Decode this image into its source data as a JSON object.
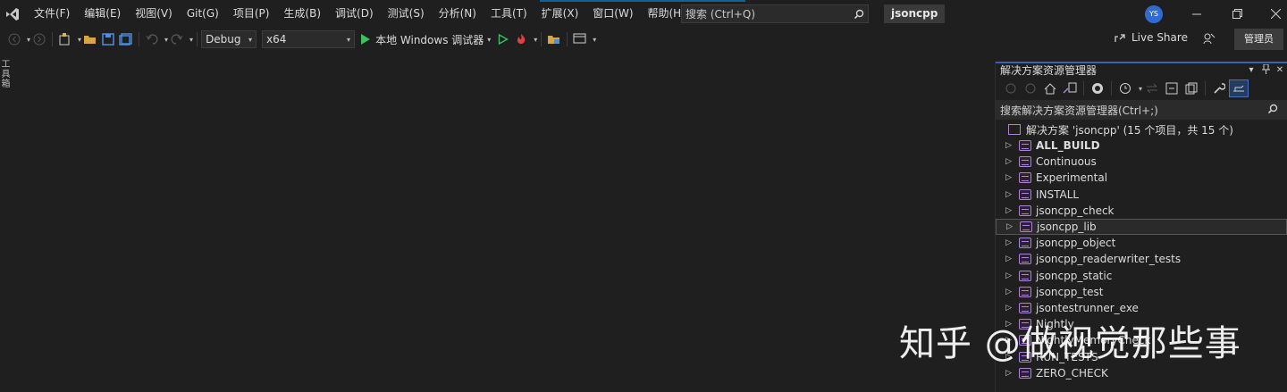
{
  "titlebar": {
    "menu": [
      "文件(F)",
      "编辑(E)",
      "视图(V)",
      "Git(G)",
      "项目(P)",
      "生成(B)",
      "调试(D)",
      "测试(S)",
      "分析(N)",
      "工具(T)",
      "扩展(X)",
      "窗口(W)",
      "帮助(H)"
    ],
    "search_placeholder": "搜索 (Ctrl+Q)",
    "project_name": "jsoncpp",
    "avatar_initials": "YS"
  },
  "toolbar": {
    "configuration": "Debug",
    "platform": "x64",
    "run_label": "本地 Windows 调试器",
    "live_share": "Live Share",
    "admin": "管理员"
  },
  "toolbox_label": "工具箱",
  "solution_explorer": {
    "title": "解决方案资源管理器",
    "search_placeholder": "搜索解决方案资源管理器(Ctrl+;)",
    "solution_label": "解决方案 'jsoncpp' (15 个项目，共 15 个)",
    "projects": [
      {
        "name": "ALL_BUILD",
        "bold": true
      },
      {
        "name": "Continuous"
      },
      {
        "name": "Experimental"
      },
      {
        "name": "INSTALL"
      },
      {
        "name": "jsoncpp_check"
      },
      {
        "name": "jsoncpp_lib",
        "selected": true
      },
      {
        "name": "jsoncpp_object"
      },
      {
        "name": "jsoncpp_readerwriter_tests"
      },
      {
        "name": "jsoncpp_static"
      },
      {
        "name": "jsoncpp_test"
      },
      {
        "name": "jsontestrunner_exe"
      },
      {
        "name": "Nightly"
      },
      {
        "name": "NightlyMemoryCheck"
      },
      {
        "name": "RUN_TESTS"
      },
      {
        "name": "ZERO_CHECK"
      }
    ]
  },
  "watermark": "知乎 @做视觉那些事",
  "colors": {
    "background": "#1f1f1f",
    "accent": "#3c5fb0",
    "project_icon": "#b180d7",
    "run_green": "#3fbf5f"
  }
}
